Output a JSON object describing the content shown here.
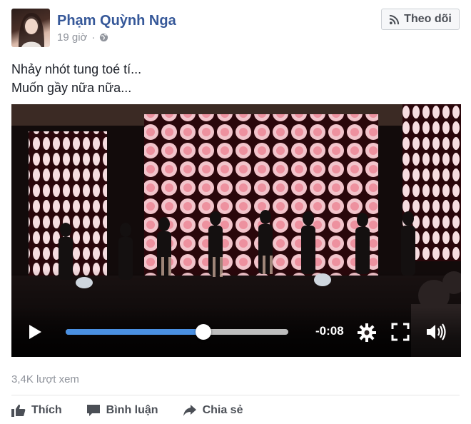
{
  "author": {
    "name": "Phạm Quỳnh Nga",
    "time": "19 giờ",
    "privacy_icon": "globe-icon"
  },
  "follow_button": {
    "label": "Theo dõi",
    "icon": "rss-icon"
  },
  "post": {
    "lines": [
      "Nhảy nhót tung toé tí...",
      "Muốn gầy nữa nữa..."
    ]
  },
  "video": {
    "time_remaining": "-0:08",
    "progress": 0.62,
    "icons": [
      "play-icon",
      "gear-icon",
      "fullscreen-icon",
      "volume-icon"
    ]
  },
  "stats": {
    "views": "3,4K lượt xem"
  },
  "actions": [
    {
      "label": "Thích",
      "icon": "thumbs-up-icon"
    },
    {
      "label": "Bình luận",
      "icon": "comment-icon"
    },
    {
      "label": "Chia sẻ",
      "icon": "share-icon"
    }
  ],
  "colors": {
    "link_blue": "#365899",
    "progress_blue": "#4a90e2",
    "muted": "#90949c"
  }
}
